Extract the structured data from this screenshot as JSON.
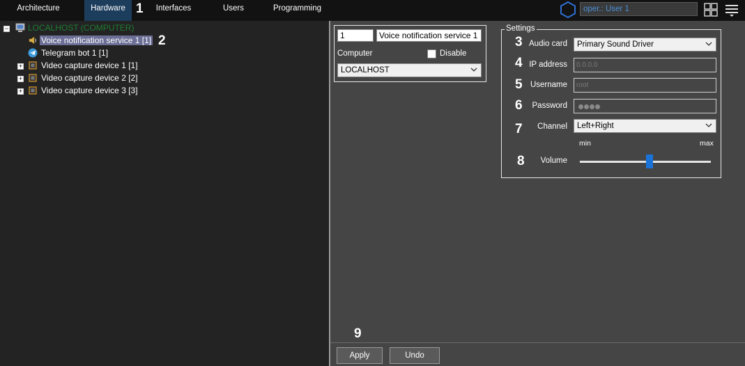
{
  "tabs": [
    {
      "label": "Architecture"
    },
    {
      "label": "Hardware"
    },
    {
      "label": "Interfaces"
    },
    {
      "label": "Users"
    },
    {
      "label": "Programming"
    }
  ],
  "user_field": "oper.: User 1",
  "markers": [
    "1",
    "2",
    "3",
    "4",
    "5",
    "6",
    "7",
    "8",
    "9"
  ],
  "tree": {
    "root": "LOCALHOST (COMPUTER)",
    "items": [
      {
        "label": "Voice notification service 1 [1]"
      },
      {
        "label": "Telegram bot 1 [1]"
      },
      {
        "label": "Video capture device 1 [1]"
      },
      {
        "label": "Video capture device 2 [2]"
      },
      {
        "label": "Video capture device 3 [3]"
      }
    ]
  },
  "object": {
    "id": "1",
    "name": "Voice notification service 1",
    "computer_label": "Computer",
    "computer_value": "LOCALHOST",
    "disable_label": "Disable"
  },
  "settings": {
    "title": "Settings",
    "audio_card_label": "Audio card",
    "audio_card_value": "Primary Sound Driver",
    "ip_label": "IP address",
    "ip_placeholder": "0.0.0.0",
    "username_label": "Username",
    "username_placeholder": "root",
    "password_label": "Password",
    "channel_label": "Channel",
    "channel_value": "Left+Right",
    "min_label": "min",
    "max_label": "max",
    "volume_label": "Volume",
    "volume_level": 0.53
  },
  "buttons": {
    "apply": "Apply",
    "undo": "Undo"
  },
  "colors": {
    "active_tab": "#1c3d5c",
    "selection": "#6b6e95",
    "slider_thumb": "#1a73d8",
    "root_text": "#1e7d32",
    "user_text": "#4a90d9"
  }
}
